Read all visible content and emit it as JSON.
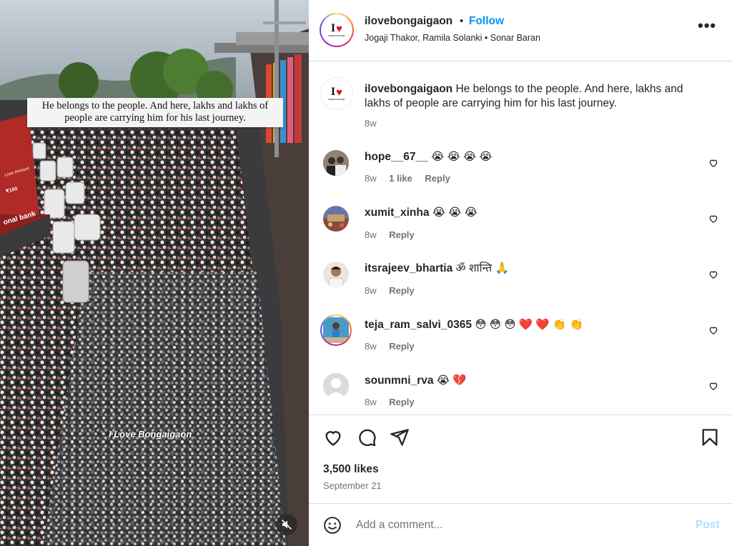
{
  "media": {
    "caption": "He belongs to the people. And here, lakhs and lakhs of people are carrying him for his last journey.",
    "watermark": "I Love Bongaigaon",
    "billboard_text": "onal bank",
    "billboard_sub": "Loan Amount",
    "billboard_price": "₹100"
  },
  "post_header": {
    "username": "ilovebongaigaon",
    "separator": "•",
    "follow_label": "Follow",
    "audio": "Jogaji Thakor, Ramila Solanki • Sonar Baran",
    "more_label": "•••"
  },
  "brand": {
    "logo_letter": "I",
    "logo_heart": "♥",
    "logo_sub": "BONGAIGAON"
  },
  "caption_comment": {
    "username": "ilovebongaigaon",
    "text": " He belongs to the people. And here, lakhs and",
    "text2": "lakhs of people are carrying him for his last journey.",
    "time": "8w"
  },
  "comments": [
    {
      "username": "hope__67__",
      "text": " 😭 😭 😭 😭",
      "time": "8w",
      "likes": "1 like",
      "reply": "Reply"
    },
    {
      "username": "xumit_xinha",
      "text": " 😭 😭 😭",
      "time": "8w",
      "likes": "",
      "reply": "Reply"
    },
    {
      "username": "itsrajeev_bhartia",
      "text": " ॐ शान्ति 🙏",
      "time": "8w",
      "likes": "",
      "reply": "Reply"
    },
    {
      "username": "teja_ram_salvi_0365",
      "text": " 😳 😳 😳 ❤️ ❤️ 👏 👏",
      "time": "8w",
      "likes": "",
      "reply": "Reply"
    },
    {
      "username": "sounmni_rva",
      "text": " 😭 💔",
      "time": "8w",
      "likes": "",
      "reply": "Reply"
    }
  ],
  "stats": {
    "likes": "3,500 likes",
    "date": "September 21"
  },
  "composer": {
    "placeholder": "Add a comment...",
    "post_label": "Post"
  },
  "colors": {
    "accent": "#0095f6",
    "text": "#262626",
    "muted": "#737373",
    "border": "#dbdbdb"
  }
}
